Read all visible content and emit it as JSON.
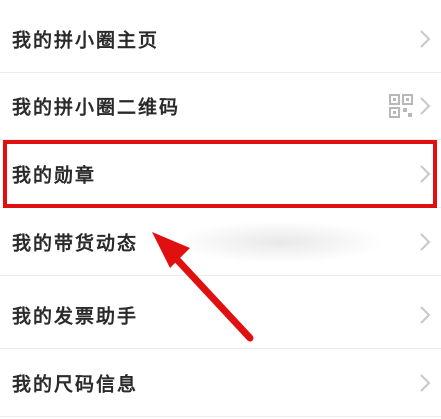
{
  "menu": {
    "items": [
      {
        "label": "我的拼小圈主页",
        "trailing": "chevron-right-icon"
      },
      {
        "label": "我的拼小圈二维码",
        "trailing": "qr-code-icon"
      },
      {
        "label": "我的勋章",
        "trailing": "chevron-right-icon"
      },
      {
        "label": "我的带货动态",
        "trailing": "chevron-right-icon"
      },
      {
        "label": "我的发票助手",
        "trailing": "chevron-right-icon"
      },
      {
        "label": "我的尺码信息",
        "trailing": "chevron-right-icon"
      }
    ]
  },
  "annotation": {
    "highlighted_item": "我的勋章",
    "highlight_color": "#e01010",
    "arrow_color": "#e01010"
  },
  "colors": {
    "text": "#2a2a2a",
    "divider": "#ececec",
    "chevron": "#c8c8c8",
    "background": "#ffffff"
  }
}
